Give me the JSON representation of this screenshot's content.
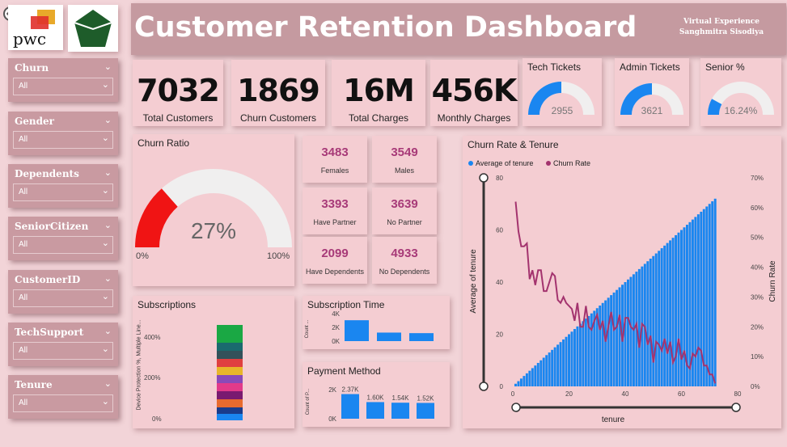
{
  "header": {
    "title": "Customer Retention Dashboard",
    "subtitle_line1": "Virtual Experience",
    "subtitle_line2": "Sanghmitra Sisodiya",
    "logo_text": "pwc"
  },
  "slicers": [
    {
      "label": "Churn",
      "value": "All"
    },
    {
      "label": "Gender",
      "value": "All"
    },
    {
      "label": "Dependents",
      "value": "All"
    },
    {
      "label": "SeniorCitizen",
      "value": "All"
    },
    {
      "label": "CustomerID",
      "value": "All"
    },
    {
      "label": "TechSupport",
      "value": "All"
    },
    {
      "label": "Tenure",
      "value": "All"
    }
  ],
  "kpis": [
    {
      "value": "7032",
      "label": "Total Customers"
    },
    {
      "value": "1869",
      "label": "Churn Customers"
    },
    {
      "value": "16M",
      "label": "Total Charges"
    },
    {
      "value": "456K",
      "label": "Monthly Charges"
    }
  ],
  "gauges": {
    "tech": {
      "title": "Tech Tickets",
      "value": "2955",
      "fraction": 0.5
    },
    "admin": {
      "title": "Admin Tickets",
      "value": "3621",
      "fraction": 0.5
    },
    "senior": {
      "title": "Senior %",
      "value": "16.24%",
      "fraction": 0.16
    }
  },
  "churn_ratio": {
    "title": "Churn Ratio",
    "value": "27%",
    "fraction": 0.27,
    "min": "0%",
    "max": "100%"
  },
  "stats": [
    {
      "value": "3483",
      "label": "Females"
    },
    {
      "value": "3549",
      "label": "Males"
    },
    {
      "value": "3393",
      "label": "Have Partner"
    },
    {
      "value": "3639",
      "label": "No Partner"
    },
    {
      "value": "2099",
      "label": "Have Dependents"
    },
    {
      "value": "4933",
      "label": "No Dependents"
    }
  ],
  "colors": {
    "blue": "#1a86f0",
    "purple": "#a3336e",
    "red": "#f01414",
    "gauge_bg": "#f0efef"
  },
  "subscriptions": {
    "title": "Subscriptions",
    "ylabel": "Device Protection %, Multiple Line...",
    "ticks": [
      "400%",
      "200%",
      "0%"
    ],
    "segments": [
      {
        "color": "#1a86f0"
      },
      {
        "color": "#1a3c8c"
      },
      {
        "color": "#e86a2e"
      },
      {
        "color": "#7a1a70"
      },
      {
        "color": "#e23a8a"
      },
      {
        "color": "#8a4ab8"
      },
      {
        "color": "#e8b62a"
      },
      {
        "color": "#e04040"
      },
      {
        "color": "#33515a"
      },
      {
        "color": "#1a6a6e"
      },
      {
        "color": "#1aa844"
      }
    ]
  },
  "chart_data": [
    {
      "type": "bar",
      "title": "Subscription Time",
      "ylabel": "Count ...",
      "yticks": [
        "4K",
        "2K",
        "0K"
      ],
      "ylim": [
        0,
        5000
      ],
      "values": [
        3800,
        1550,
        1450
      ]
    },
    {
      "type": "bar",
      "title": "Payment Method",
      "ylabel": "Count of P...",
      "yticks": [
        "2K",
        "0K"
      ],
      "ylim": [
        0,
        2800
      ],
      "values": [
        2370,
        1600,
        1540,
        1520
      ],
      "data_labels": [
        "2.37K",
        "1.60K",
        "1.54K",
        "1.52K"
      ]
    },
    {
      "type": "bar+line",
      "title": "Churn Rate & Tenure",
      "legend": [
        "Average of tenure",
        "Churn Rate"
      ],
      "xlabel": "tenure",
      "ylabel_left": "Average of tenure",
      "ylabel_right": "Churn Rate",
      "x_ticks": [
        "0",
        "20",
        "40",
        "60",
        "80"
      ],
      "y_left_ticks": [
        "0",
        "20",
        "40",
        "60",
        "80"
      ],
      "y_right_ticks": [
        "0%",
        "10%",
        "20%",
        "30%",
        "40%",
        "50%",
        "60%",
        "70%"
      ],
      "xlim": [
        0,
        80
      ],
      "ylim_left": [
        0,
        80
      ],
      "ylim_right": [
        0,
        0.7
      ],
      "tenure": [
        1,
        2,
        3,
        4,
        5,
        6,
        7,
        8,
        9,
        10,
        11,
        12,
        13,
        14,
        15,
        16,
        17,
        18,
        19,
        20,
        21,
        22,
        23,
        24,
        25,
        26,
        27,
        28,
        29,
        30,
        31,
        32,
        33,
        34,
        35,
        36,
        37,
        38,
        39,
        40,
        41,
        42,
        43,
        44,
        45,
        46,
        47,
        48,
        49,
        50,
        51,
        52,
        53,
        54,
        55,
        56,
        57,
        58,
        59,
        60,
        61,
        62,
        63,
        64,
        65,
        66,
        67,
        68,
        69,
        70,
        71,
        72
      ],
      "churn_rate": [
        0.62,
        0.52,
        0.47,
        0.47,
        0.48,
        0.36,
        0.39,
        0.34,
        0.39,
        0.39,
        0.32,
        0.32,
        0.35,
        0.38,
        0.37,
        0.29,
        0.28,
        0.3,
        0.28,
        0.27,
        0.26,
        0.22,
        0.28,
        0.2,
        0.2,
        0.27,
        0.2,
        0.19,
        0.22,
        0.24,
        0.19,
        0.22,
        0.15,
        0.2,
        0.25,
        0.19,
        0.2,
        0.24,
        0.15,
        0.23,
        0.23,
        0.2,
        0.19,
        0.21,
        0.13,
        0.21,
        0.2,
        0.14,
        0.17,
        0.08,
        0.15,
        0.14,
        0.12,
        0.16,
        0.11,
        0.15,
        0.08,
        0.1,
        0.16,
        0.09,
        0.12,
        0.07,
        0.06,
        0.11,
        0.1,
        0.13,
        0.12,
        0.07,
        0.07,
        0.04,
        0.04,
        0.01
      ]
    }
  ]
}
